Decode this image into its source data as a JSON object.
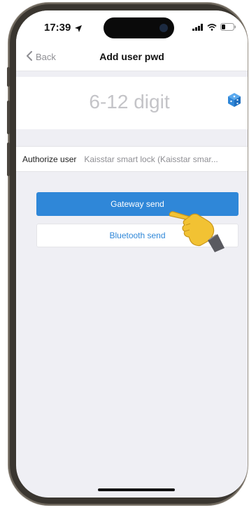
{
  "status_bar": {
    "time": "17:39"
  },
  "nav": {
    "back_label": "Back",
    "title": "Add user pwd"
  },
  "password": {
    "placeholder": "6-12 digit",
    "generate_icon": "dice-icon"
  },
  "authorize": {
    "label": "Authorize user",
    "value": "Kaisstar smart lock (Kaisstar smar..."
  },
  "actions": {
    "gateway_label": "Gateway send",
    "bluetooth_label": "Bluetooth send"
  },
  "colors": {
    "accent": "#2f87d8",
    "background": "#efeff4",
    "hand": "#f2c233"
  }
}
